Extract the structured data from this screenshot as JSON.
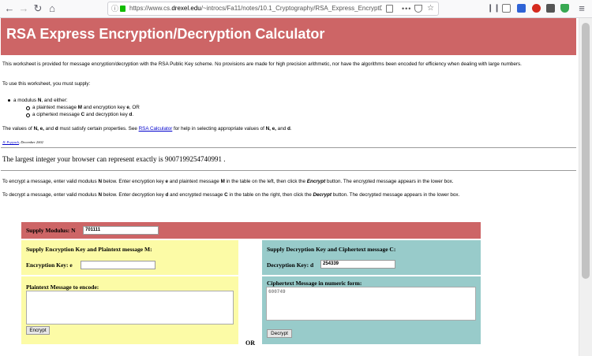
{
  "browser": {
    "url_prefix": "https://www.cs.",
    "url_domain": "drexel.edu",
    "url_path": "/~introcs/Fa11/notes/10.1_Cryptography/RSA_Express_EncryptDe",
    "icons": {
      "back": "back-arrow-icon",
      "forward": "forward-arrow-icon",
      "reload": "reload-icon",
      "home": "home-icon"
    }
  },
  "page": {
    "title": "RSA Express Encryption/Decryption Calculator",
    "intro": "This worksheet is provided for message encryption/decryption with the RSA Public Key scheme. No provisions are made for high precision arithmetic, nor have the algorithms been encoded for efficiency when dealing with large numbers.",
    "supply_intro": "To use this worksheet, you must supply:",
    "bullet_modulus_pre": "a modulus ",
    "bullet_modulus_var": "N",
    "bullet_modulus_post": ", and either:",
    "sub1_pre": "a plaintext message ",
    "sub1_var1": "M",
    "sub1_mid": " and encryption key ",
    "sub1_var2": "e",
    "sub1_post": ", OR",
    "sub2_pre": "a ciphertext message ",
    "sub2_var1": "C",
    "sub2_mid": " and decryption key ",
    "sub2_var2": "d",
    "sub2_post": ".",
    "values_pre": "The values of ",
    "values_vars": "N, e,",
    "values_and": " and ",
    "values_d": "d",
    "values_mid": " must satisfy certain properties. See ",
    "values_link": "RSA Calculator",
    "values_post1": " for help in selecting appropriate values of ",
    "values_vars2": "N, e,",
    "values_post2": " and ",
    "values_d2": "d",
    "values_end": ".",
    "sig_name": "JL Popyack",
    "sig_date": ", December 2002",
    "largest_text": "The largest integer your browser can represent exactly is 9007199254740991 .",
    "encrypt_instr_pre": "To encrypt a message, enter valid modulus ",
    "encrypt_instr_n": "N",
    "encrypt_instr_a": " below. Enter encryption key ",
    "encrypt_instr_e": "e",
    "encrypt_instr_b": " and plaintext message ",
    "encrypt_instr_m": "M",
    "encrypt_instr_c": " in the table on the left, then click the ",
    "encrypt_instr_btn": "Encrypt",
    "encrypt_instr_d": " button. The encrypted message appears in the lower box.",
    "decrypt_instr_pre": "To decrypt a message, enter valid modulus ",
    "decrypt_instr_n": "N",
    "decrypt_instr_a": " below. Enter decryption key ",
    "decrypt_instr_dk": "d",
    "decrypt_instr_b": " and encrypted message ",
    "decrypt_instr_c": "C",
    "decrypt_instr_cc": " in the table on the right, then click the ",
    "decrypt_instr_btn": "Decrypt",
    "decrypt_instr_d": " button. The decrypted message appears in the lower box."
  },
  "calculator": {
    "modulus_label": "Supply Modulus: N",
    "modulus_value": "701111",
    "enc_header": "Supply Encryption Key and Plaintext message M:",
    "enc_key_label": "Encryption Key: e",
    "enc_key_value": "",
    "plaintext_label": "Plaintext Message to encode:",
    "plaintext_value": "",
    "encrypt_button": "Encrypt",
    "or_label": "OR",
    "dec_header": "Supply Decryption Key and Ciphertext message C:",
    "dec_key_label": "Decryption Key: d",
    "dec_key_value": "254339",
    "ciphertext_label": "Ciphertext Message in numeric form:",
    "ciphertext_value": "600749",
    "decrypt_button": "Decrypt"
  },
  "colors": {
    "banner": "#cd6566",
    "encrypt_panel": "#fcfba6",
    "decrypt_panel": "#98cbca",
    "link": "#0000cc"
  }
}
